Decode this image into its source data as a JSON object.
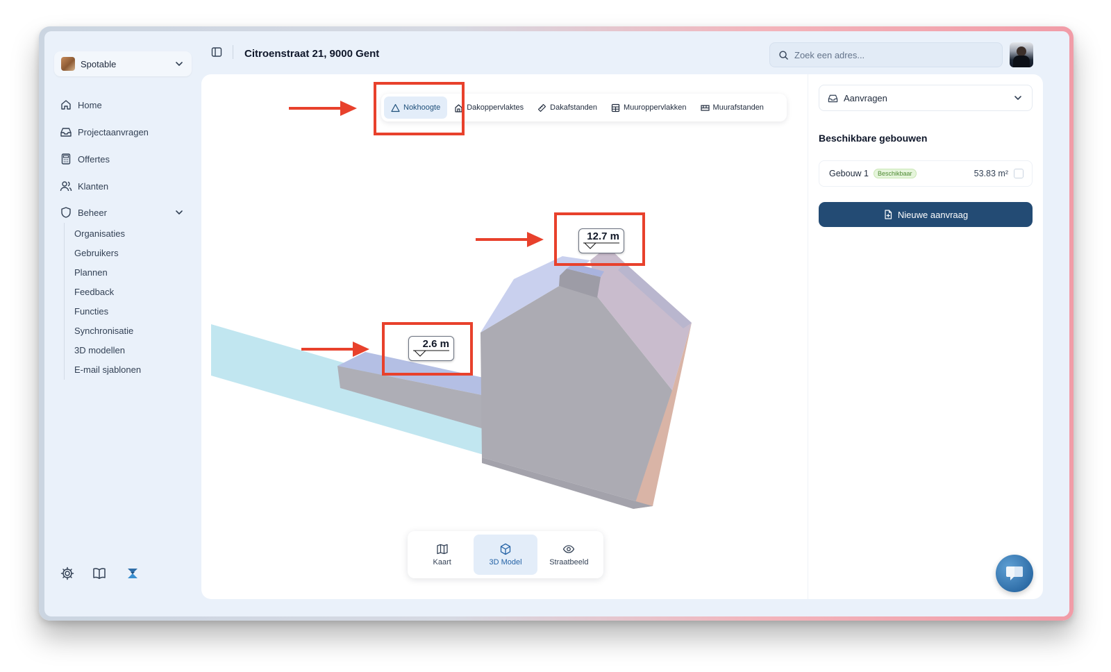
{
  "org": {
    "name": "Spotable"
  },
  "nav": {
    "items": [
      {
        "label": "Home",
        "icon": "home-icon"
      },
      {
        "label": "Projectaanvragen",
        "icon": "inbox-icon"
      },
      {
        "label": "Offertes",
        "icon": "calculator-icon"
      },
      {
        "label": "Klanten",
        "icon": "users-icon"
      },
      {
        "label": "Beheer",
        "icon": "shield-icon"
      }
    ],
    "beheer_sub": [
      "Organisaties",
      "Gebruikers",
      "Plannen",
      "Feedback",
      "Functies",
      "Synchronisatie",
      "3D modellen",
      "E-mail sjablonen"
    ]
  },
  "header": {
    "address": "Citroenstraat 21, 9000 Gent",
    "search_placeholder": "Zoek een adres..."
  },
  "measure_tabs": [
    {
      "label": "Nokhoogte",
      "icon": "triangle-icon",
      "active": true
    },
    {
      "label": "Dakoppervlaktes",
      "icon": "house-icon",
      "active": false
    },
    {
      "label": "Dakafstanden",
      "icon": "ruler-icon",
      "active": false
    },
    {
      "label": "Muuroppervlakken",
      "icon": "grid-icon",
      "active": false
    },
    {
      "label": "Muurafstanden",
      "icon": "wall-ruler-icon",
      "active": false
    }
  ],
  "measurements": {
    "ridge_height": "12.7 m",
    "annex_height": "2.6 m"
  },
  "view_modes": [
    {
      "label": "Kaart",
      "icon": "map-icon",
      "active": false
    },
    {
      "label": "3D Model",
      "icon": "cube-icon",
      "active": true
    },
    {
      "label": "Straatbeeld",
      "icon": "eye-icon",
      "active": false
    }
  ],
  "side_panel": {
    "requests_label": "Aanvragen",
    "buildings_title": "Beschikbare gebouwen",
    "building": {
      "name": "Gebouw 1",
      "status": "Beschikbaar",
      "area": "53.83 m²"
    },
    "new_request_label": "Nieuwe aanvraag"
  },
  "colors": {
    "annotation": "#e8412c",
    "primary_button": "#234b74",
    "active_tab_bg": "#e3edf9",
    "building_wall": "#a9a8b0",
    "building_roof": "#b9c0e6",
    "ground": "#bfe4ef"
  }
}
